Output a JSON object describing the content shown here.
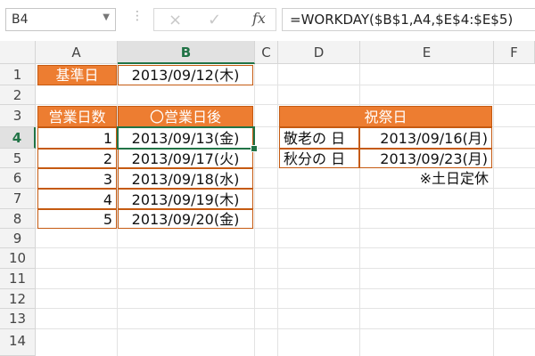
{
  "formula_bar": {
    "name_box": "B4",
    "cancel_icon": "×",
    "enter_icon": "✓",
    "fx_label": "fx",
    "formula": "=WORKDAY($B$1,A4,$E$4:$E$5)"
  },
  "columns": [
    "A",
    "B",
    "C",
    "D",
    "E",
    "F"
  ],
  "rows": [
    "1",
    "2",
    "3",
    "4",
    "5",
    "6",
    "7",
    "8",
    "9",
    "10",
    "11",
    "12",
    "13",
    "14"
  ],
  "cells": {
    "A1": "基準日",
    "B1": "2013/09/12(木)",
    "A3": "営業日数",
    "B3": "〇営業日後",
    "A4": "1",
    "B4": "2013/09/13(金)",
    "A5": "2",
    "B5": "2013/09/17(火)",
    "A6": "3",
    "B6": "2013/09/18(水)",
    "A7": "4",
    "B7": "2013/09/19(木)",
    "A8": "5",
    "B8": "2013/09/20(金)",
    "D3": "祝祭日",
    "D4": "敬老の 日",
    "E4": "2013/09/16(月)",
    "D5": "秋分の 日",
    "E5": "2013/09/23(月)",
    "E6": "※土日定休"
  },
  "colors": {
    "header_fill": "#ed7d31",
    "border": "#c55a11",
    "selection": "#217346"
  }
}
